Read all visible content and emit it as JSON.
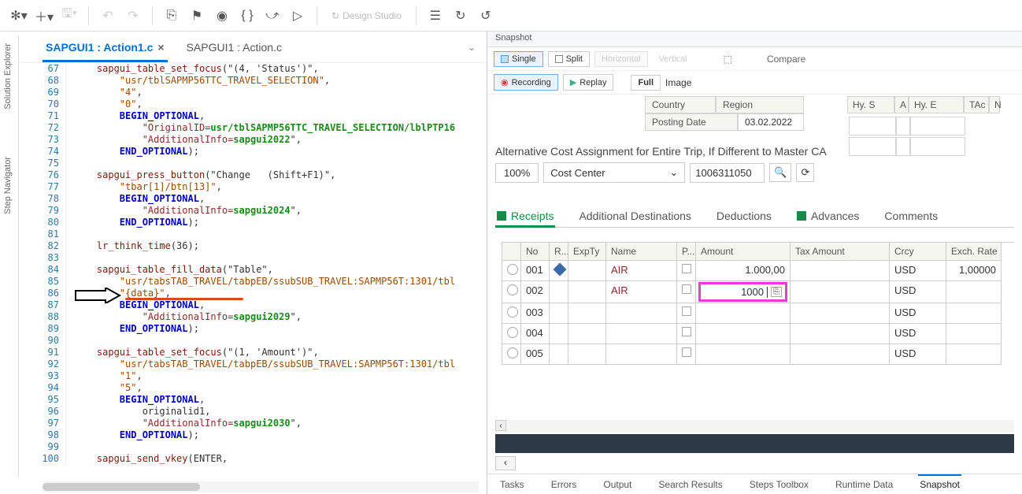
{
  "toolbar": {
    "design_studio": "Design Studio"
  },
  "sidebar": {
    "solution_explorer": "Solution Explorer",
    "step_navigator": "Step Navigator"
  },
  "tabs": [
    {
      "label": "SAPGUI1 : Action1.c",
      "active": true,
      "closable": true
    },
    {
      "label": "SAPGUI1 : Action.c",
      "active": false,
      "closable": false
    }
  ],
  "code": {
    "first_line": 67,
    "lines": [
      {
        "i": "    ",
        "fn": "sapgui_table_set_focus",
        "rest": "(\"(4, 'Status')\","
      },
      {
        "i": "        ",
        "str": "\"usr/tblSAPMP56TTC_TRAVEL_SELECTION\"",
        "rest": ","
      },
      {
        "i": "        ",
        "str": "\"4\"",
        "rest": ","
      },
      {
        "i": "        ",
        "str": "\"0\"",
        "rest": ","
      },
      {
        "i": "        ",
        "const": "BEGIN_OPTIONAL",
        "rest": ","
      },
      {
        "i": "            ",
        "key": "\"OriginalID=",
        "val": "usr/tblSAPMP56TTC_TRAVEL_SELECTION/lblPTP16"
      },
      {
        "i": "            ",
        "key": "\"AdditionalInfo=",
        "val": "sapgui2022",
        "rest": "\","
      },
      {
        "i": "        ",
        "const": "END_OPTIONAL",
        "rest": ");"
      },
      {
        "i": ""
      },
      {
        "i": "    ",
        "fn": "sapgui_press_button",
        "rest": "(\"Change   (Shift+F1)\","
      },
      {
        "i": "        ",
        "str": "\"tbar[1]/btn[13]\"",
        "rest": ","
      },
      {
        "i": "        ",
        "const": "BEGIN_OPTIONAL",
        "rest": ","
      },
      {
        "i": "            ",
        "key": "\"AdditionalInfo=",
        "val": "sapgui2024",
        "rest": "\","
      },
      {
        "i": "        ",
        "const": "END_OPTIONAL",
        "rest": ");"
      },
      {
        "i": ""
      },
      {
        "i": "    ",
        "fn": "lr_think_time",
        "rest": "(36);"
      },
      {
        "i": ""
      },
      {
        "i": "    ",
        "fn": "sapgui_table_fill_data",
        "rest": "(\"Table\","
      },
      {
        "i": "        ",
        "str": "\"usr/tabsTAB_TRAVEL/tabpEB/ssubSUB_TRAVEL:SAPMP56T:1301/tbl",
        "rest": ""
      },
      {
        "i": "        ",
        "str": "\"{data}\"",
        "rest": ","
      },
      {
        "i": "        ",
        "const": "BEGIN_OPTIONAL",
        "rest": ","
      },
      {
        "i": "            ",
        "key": "\"AdditionalInfo=",
        "val": "sapgui2029",
        "rest": "\","
      },
      {
        "i": "        ",
        "const": "END_OPTIONAL",
        "rest": ");"
      },
      {
        "i": ""
      },
      {
        "i": "    ",
        "fn": "sapgui_table_set_focus",
        "rest": "(\"(1, 'Amount')\","
      },
      {
        "i": "        ",
        "str": "\"usr/tabsTAB_TRAVEL/tabpEB/ssubSUB_TRAVEL:SAPMP56T:1301/tbl",
        "rest": ""
      },
      {
        "i": "        ",
        "str": "\"1\"",
        "rest": ","
      },
      {
        "i": "        ",
        "str": "\"5\"",
        "rest": ","
      },
      {
        "i": "        ",
        "const": "BEGIN_OPTIONAL",
        "rest": ","
      },
      {
        "i": "            ",
        "plain": "originalid1,",
        "rest": ""
      },
      {
        "i": "            ",
        "key": "\"AdditionalInfo=",
        "val": "sapgui2030",
        "rest": "\","
      },
      {
        "i": "        ",
        "const": "END_OPTIONAL",
        "rest": ");"
      },
      {
        "i": ""
      },
      {
        "i": "    ",
        "fn": "sapgui_send_vkey",
        "rest": "(ENTER,"
      }
    ]
  },
  "snapshot": {
    "title": "Snapshot",
    "view_single": "Single",
    "view_split": "Split",
    "view_horizontal": "Horizontal",
    "view_vertical": "Vertical",
    "compare": "Compare",
    "recording": "Recording",
    "replay": "Replay",
    "full": "Full",
    "image": "Image"
  },
  "app": {
    "country": "Country",
    "region": "Region",
    "posting_date": "Posting Date",
    "posting_date_val": "03.02.2022",
    "hys": "Hy. S",
    "a_col": "A",
    "hye": "Hy. E",
    "tac": "TAc",
    "n": "N",
    "alt_cost": "Alternative Cost Assignment for Entire Trip, If Different to Master CA",
    "zoom": "100%",
    "cost_center": "Cost Center",
    "cost_value": "1006311050",
    "tabs": {
      "receipts": "Receipts",
      "additional": "Additional Destinations",
      "deductions": "Deductions",
      "advances": "Advances",
      "comments": "Comments"
    },
    "grid": {
      "headers": {
        "no": "No",
        "r": "R...",
        "exp": "ExpTy",
        "name": "Name",
        "p": "P...",
        "amount": "Amount",
        "tax": "Tax Amount",
        "crcy": "Crcy",
        "exch": "Exch. Rate"
      },
      "rows": [
        {
          "no": "001",
          "exp": "",
          "name": "AIR",
          "amount": "1.000,00",
          "tax": "",
          "crcy": "USD",
          "exch": "1,00000",
          "diamond": true
        },
        {
          "no": "002",
          "exp": "",
          "name": "AIR",
          "amount": "1000",
          "tax": "",
          "crcy": "USD",
          "exch": "",
          "highlight": true
        },
        {
          "no": "003",
          "exp": "",
          "name": "",
          "amount": "",
          "tax": "",
          "crcy": "USD",
          "exch": ""
        },
        {
          "no": "004",
          "exp": "",
          "name": "",
          "amount": "",
          "tax": "",
          "crcy": "USD",
          "exch": ""
        },
        {
          "no": "005",
          "exp": "",
          "name": "",
          "amount": "",
          "tax": "",
          "crcy": "USD",
          "exch": ""
        }
      ]
    }
  },
  "bottom_tabs": [
    "Tasks",
    "Errors",
    "Output",
    "Search Results",
    "Steps Toolbox",
    "Runtime Data",
    "Snapshot"
  ]
}
